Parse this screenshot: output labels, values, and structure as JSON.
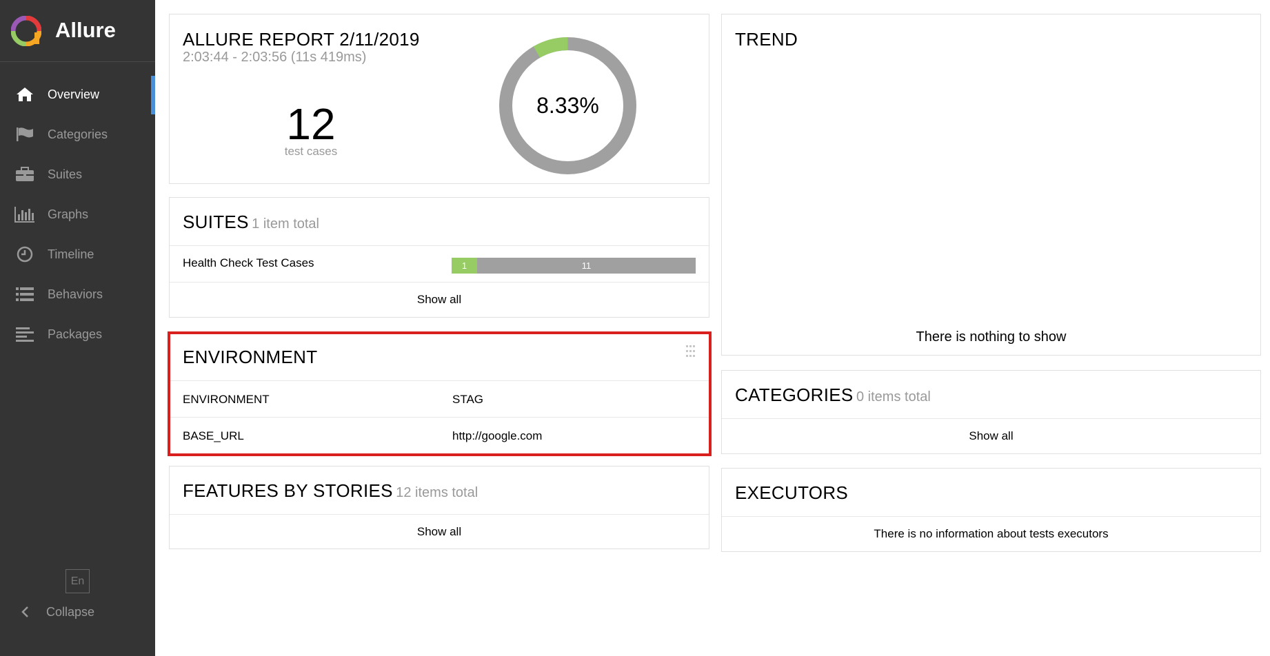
{
  "app": {
    "title": "Allure"
  },
  "sidebar": {
    "items": [
      {
        "label": "Overview",
        "icon": "home-icon",
        "active": true
      },
      {
        "label": "Categories",
        "icon": "flag-icon",
        "active": false
      },
      {
        "label": "Suites",
        "icon": "briefcase-icon",
        "active": false
      },
      {
        "label": "Graphs",
        "icon": "bar-chart-icon",
        "active": false
      },
      {
        "label": "Timeline",
        "icon": "clock-icon",
        "active": false
      },
      {
        "label": "Behaviors",
        "icon": "list-icon",
        "active": false
      },
      {
        "label": "Packages",
        "icon": "align-left-icon",
        "active": false
      }
    ],
    "language": "En",
    "collapse_label": "Collapse"
  },
  "summary": {
    "title": "ALLURE REPORT 2/11/2019",
    "time": "2:03:44 - 2:03:56 (11s 419ms)",
    "count": "12",
    "count_label": "test cases",
    "percent": "8.33%",
    "passed_fraction": 0.0833
  },
  "suites": {
    "title": "SUITES",
    "subtitle": "1 item total",
    "rows": [
      {
        "name": "Health Check Test Cases",
        "passed": "1",
        "other": "11"
      }
    ],
    "show_all": "Show all"
  },
  "environment": {
    "title": "ENVIRONMENT",
    "rows": [
      {
        "key": "ENVIRONMENT",
        "value": "STAG"
      },
      {
        "key": "BASE_URL",
        "value": "http://google.com"
      }
    ]
  },
  "features": {
    "title": "FEATURES BY STORIES",
    "subtitle": "12 items total",
    "show_all": "Show all"
  },
  "trend": {
    "title": "TREND",
    "empty": "There is nothing to show"
  },
  "categories": {
    "title": "CATEGORIES",
    "subtitle": "0 items total",
    "show_all": "Show all"
  },
  "executors": {
    "title": "EXECUTORS",
    "empty": "There is no information about tests executors"
  },
  "colors": {
    "sidebar_bg": "#343434",
    "active_marker": "#4a90d9",
    "passed": "#97cc64",
    "other": "#a0a0a0",
    "highlight": "#d9201f"
  }
}
